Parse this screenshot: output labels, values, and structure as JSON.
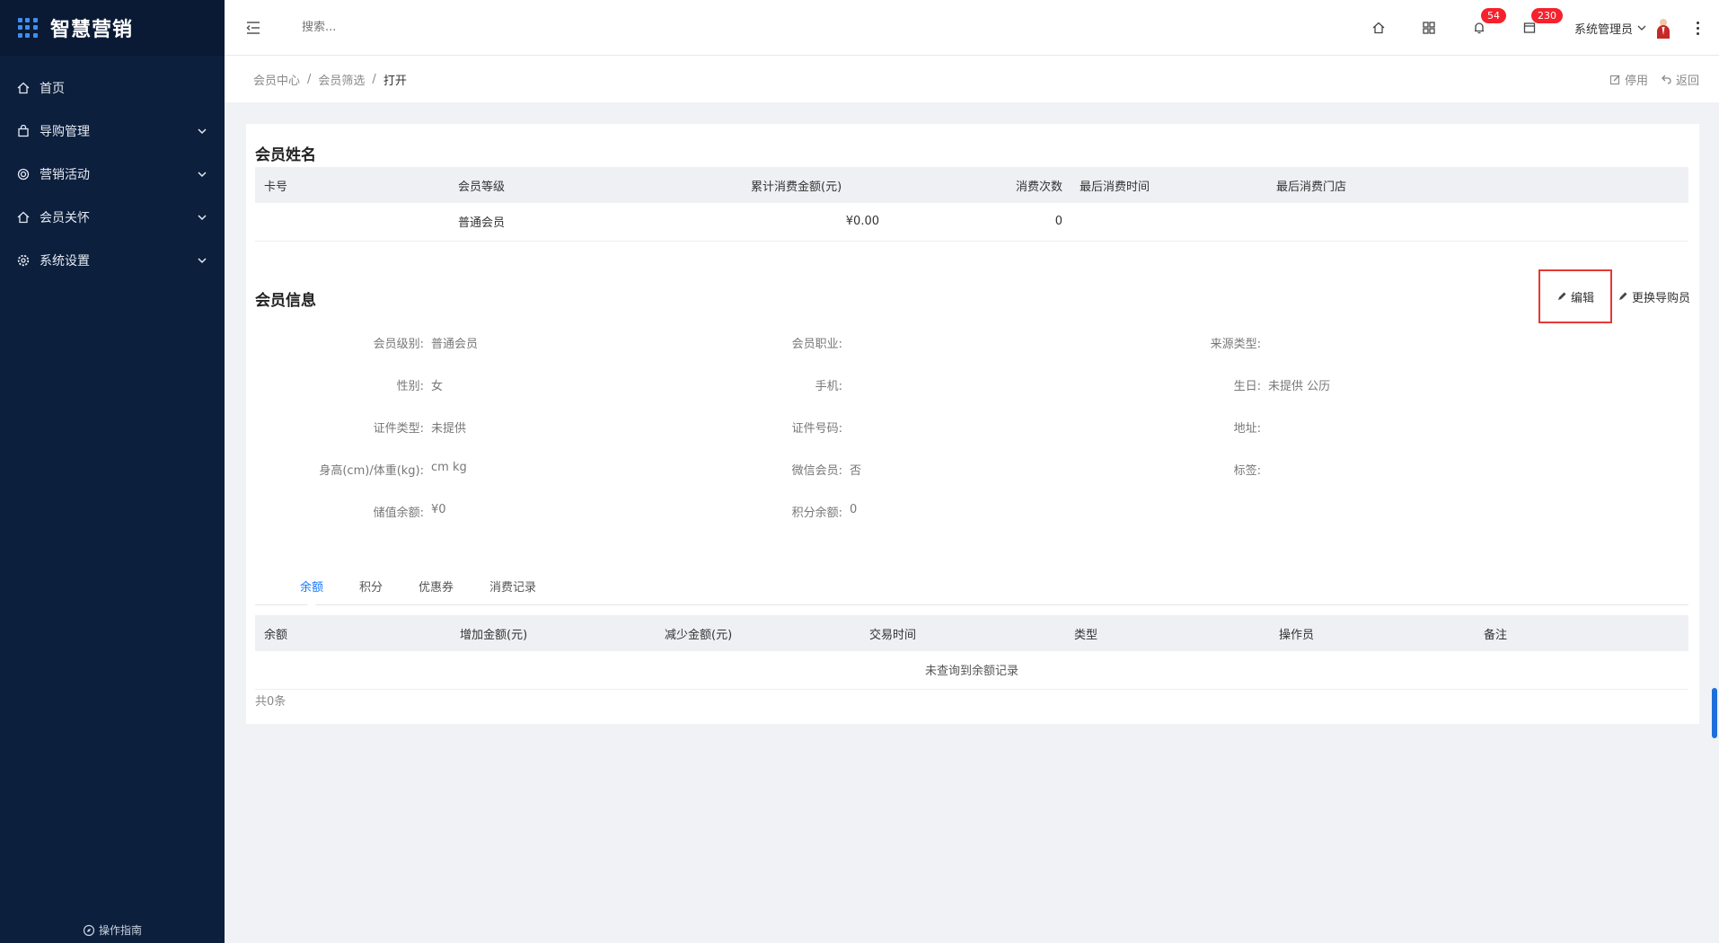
{
  "app": {
    "title": "智慧营销"
  },
  "sidebar": {
    "items": [
      {
        "label": "首页",
        "icon": "home-icon"
      },
      {
        "label": "导购管理",
        "icon": "bag-icon"
      },
      {
        "label": "营销活动",
        "icon": "target-icon"
      },
      {
        "label": "会员关怀",
        "icon": "home-heart-icon"
      },
      {
        "label": "系统设置",
        "icon": "gear-icon"
      }
    ],
    "guide_label": "操作指南"
  },
  "header": {
    "search_placeholder": "搜索...",
    "bell_count": "54",
    "message_count": "230",
    "user_name": "系统管理员"
  },
  "breadcrumb": {
    "items": [
      "会员中心",
      "会员筛选",
      "打开"
    ],
    "disable_label": "停用",
    "back_label": "返回"
  },
  "member_summary": {
    "title": "会员姓名",
    "columns": [
      "卡号",
      "会员等级",
      "累计消费金额(元)",
      "消费次数",
      "最后消费时间",
      "最后消费门店"
    ],
    "row": [
      "",
      "普通会员",
      "¥0.00",
      "0",
      "",
      ""
    ]
  },
  "member_info": {
    "title": "会员信息",
    "edit_label": "编辑",
    "change_guide_label": "更换导购员",
    "rows": [
      [
        {
          "label": "会员级别:",
          "value": "普通会员"
        },
        {
          "label": "会员职业:",
          "value": ""
        },
        {
          "label": "来源类型:",
          "value": ""
        }
      ],
      [
        {
          "label": "性别:",
          "value": "女"
        },
        {
          "label": "手机:",
          "value": ""
        },
        {
          "label": "生日:",
          "value": "未提供 公历"
        }
      ],
      [
        {
          "label": "证件类型:",
          "value": "未提供"
        },
        {
          "label": "证件号码:",
          "value": ""
        },
        {
          "label": "地址:",
          "value": ""
        }
      ],
      [
        {
          "label": "身高(cm)/体重(kg):",
          "value": "cm kg"
        },
        {
          "label": "微信会员:",
          "value": "否"
        },
        {
          "label": "标签:",
          "value": ""
        }
      ],
      [
        {
          "label": "储值余额:",
          "value": "¥0"
        },
        {
          "label": "积分余额:",
          "value": "0"
        },
        {
          "label": "",
          "value": ""
        }
      ]
    ]
  },
  "tabs": [
    "余额",
    "积分",
    "优惠券",
    "消费记录"
  ],
  "balance_table": {
    "columns": [
      "余额",
      "增加金额(元)",
      "减少金额(元)",
      "交易时间",
      "类型",
      "操作员",
      "备注"
    ],
    "empty_text": "未查询到余额记录",
    "count_text": "共0条"
  },
  "colors": {
    "sidebar_bg": "#0c1f3d",
    "accent": "#1677ff",
    "badge": "#f5222d",
    "highlight_box": "#e53935"
  }
}
